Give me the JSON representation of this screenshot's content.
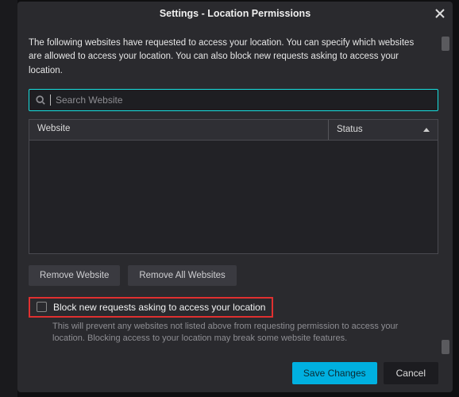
{
  "title": "Settings - Location Permissions",
  "intro": "The following websites have requested to access your location. You can specify which websites are allowed to access your location. You can also block new requests asking to access your location.",
  "search": {
    "placeholder": "Search Website",
    "value": ""
  },
  "table": {
    "columns": {
      "website": "Website",
      "status": "Status"
    },
    "rows": []
  },
  "buttons": {
    "remove": "Remove Website",
    "remove_all": "Remove All Websites",
    "save": "Save Changes",
    "cancel": "Cancel"
  },
  "block_checkbox": {
    "label": "Block new requests asking to access your location",
    "checked": false,
    "hint": "This will prevent any websites not listed above from requesting permission to access your location. Blocking access to your location may break some website features."
  }
}
